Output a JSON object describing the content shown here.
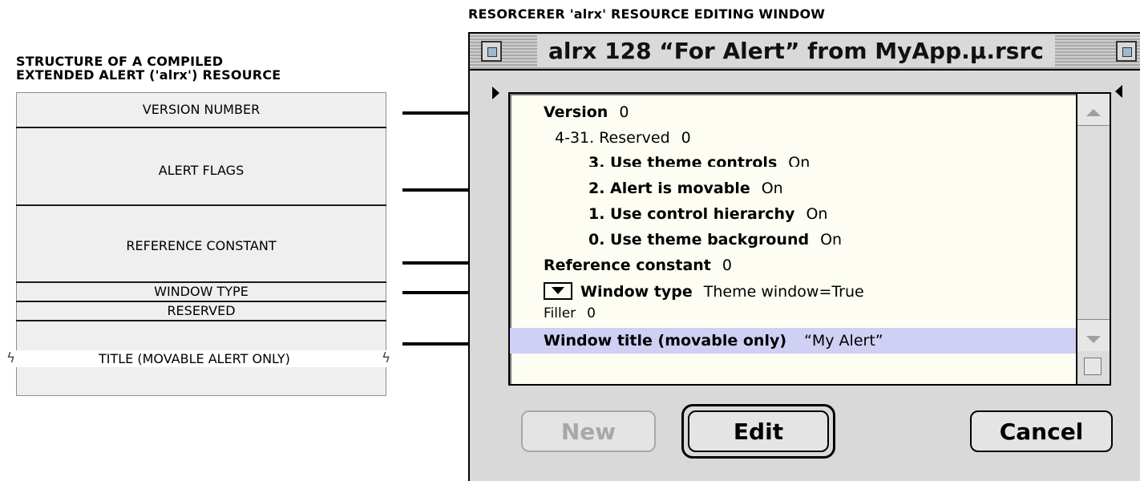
{
  "diagram": {
    "editor_caption": "RESORCERER 'alrx' RESOURCE EDITING WINDOW",
    "structure_title_line1": "STRUCTURE OF A COMPILED",
    "structure_title_line2": "EXTENDED ALERT ('alrx') RESOURCE",
    "segments": {
      "version": "VERSION NUMBER",
      "flags": "ALERT FLAGS",
      "refcon": "REFERENCE CONSTANT",
      "window_type": "WINDOW TYPE",
      "reserved": "RESERVED",
      "title": "TITLE (MOVABLE ALERT ONLY)"
    }
  },
  "window": {
    "title": "alrx 128 “For Alert” from MyApp.µ.rsrc",
    "rows": {
      "version": {
        "label": "Version",
        "value": "0"
      },
      "reserved": {
        "label": "4-31. Reserved",
        "value": "0"
      },
      "theme_ctrls": {
        "label": "3. Use theme controls",
        "value": "On"
      },
      "movable": {
        "label": "2. Alert is movable",
        "value": "On"
      },
      "hierarchy": {
        "label": "1. Use control hierarchy",
        "value": "On"
      },
      "theme_bg": {
        "label": "0. Use theme background",
        "value": "On"
      },
      "refcon": {
        "label": "Reference constant",
        "value": "0"
      },
      "window_type": {
        "label": "Window type",
        "value": "Theme window=True"
      },
      "filler": {
        "label": "Filler",
        "value": "0"
      },
      "window_title": {
        "label": "Window title (movable only)",
        "value": "“My Alert”"
      }
    },
    "buttons": {
      "new": "New",
      "edit": "Edit",
      "cancel": "Cancel"
    }
  },
  "colors": {
    "highlight": "#cfd0f3",
    "list_background": "#fdfdf3",
    "structure_fill": "#efefef"
  }
}
